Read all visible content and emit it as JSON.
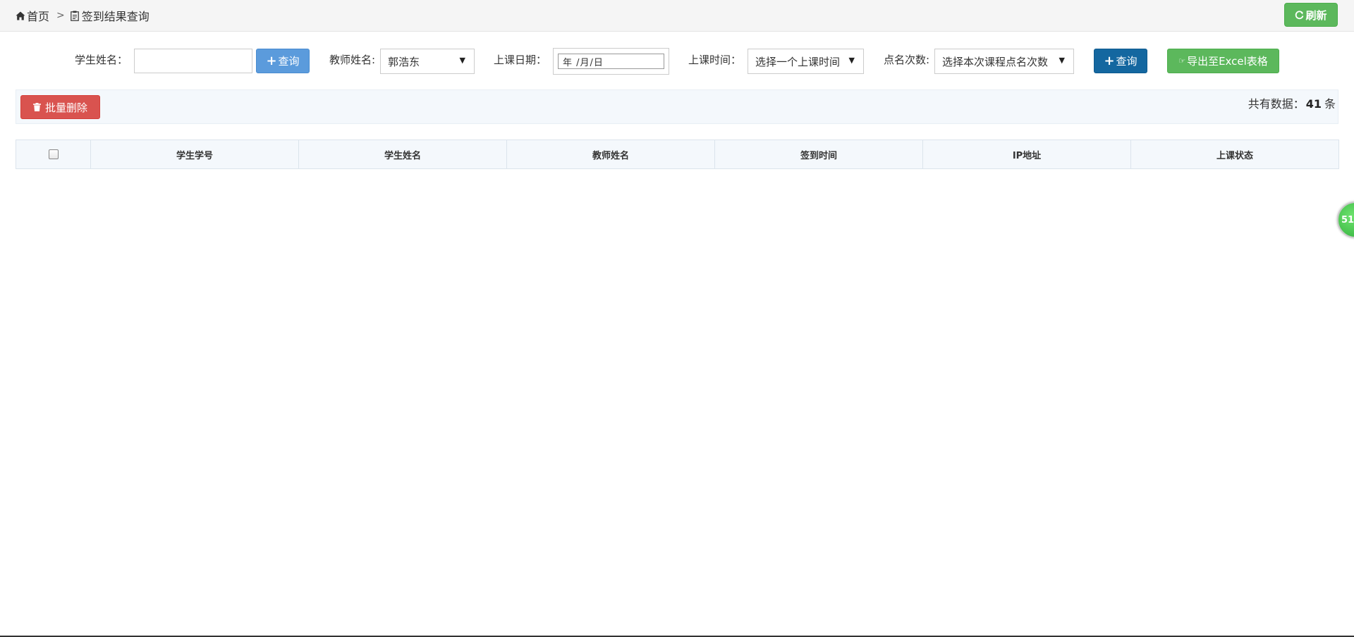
{
  "breadcrumb": {
    "home_label": "首页",
    "separator": ">",
    "current_label": "签到结果查询",
    "home_icon": "home-icon",
    "page_icon": "clipboard-icon"
  },
  "header": {
    "refresh_label": "刷新",
    "refresh_icon": "refresh-icon"
  },
  "filters": {
    "student_name_label": "学生姓名：",
    "student_name_value": "",
    "query_button_label": "查询",
    "teacher_name_label": "教师姓名:",
    "teacher_name_value": "郭浩东",
    "date_label": "上课日期：",
    "date_placeholder": "年 /月/日",
    "time_label": "上课时间：",
    "time_value": "选择一个上课时间",
    "rollcall_label": "点名次数:",
    "rollcall_value": "选择本次课程点名次数",
    "query2_button_label": "查询",
    "export_button_label": "导出至Excel表格"
  },
  "toolbar": {
    "batch_delete_label": "批量删除",
    "count_prefix": "共有数据：",
    "count_value": "41",
    "count_suffix": "条"
  },
  "table": {
    "columns": [
      "学生学号",
      "学生姓名",
      "教师姓名",
      "签到时间",
      "IP地址",
      "上课状态"
    ],
    "rows": []
  },
  "floating_badge": {
    "text": "51"
  },
  "colors": {
    "green": "#5cb85c",
    "light_blue": "#5b9bdc",
    "dark_blue": "#1467a0",
    "red": "#d9534f"
  }
}
